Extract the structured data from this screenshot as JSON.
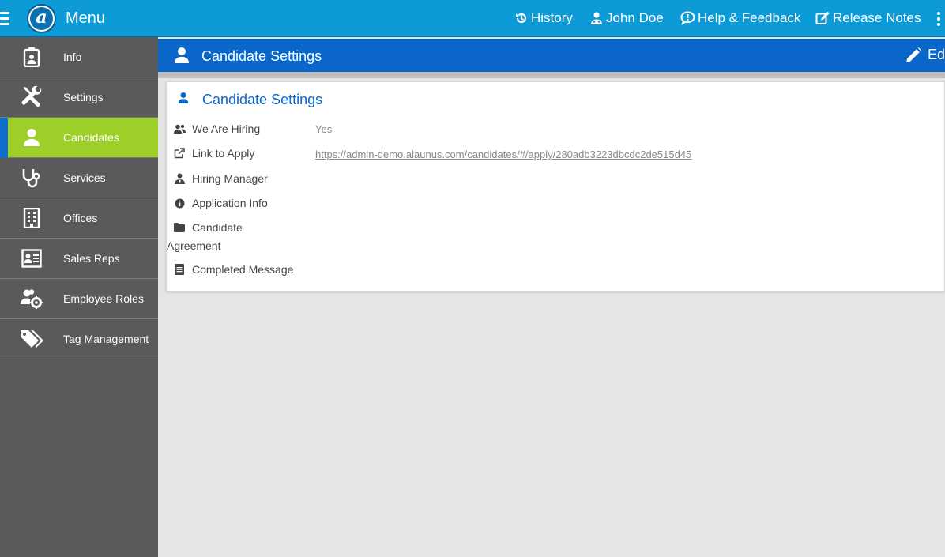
{
  "topbar": {
    "menu_label": "Menu",
    "logo_letter": "a",
    "links": {
      "history": "History",
      "user": "John Doe",
      "help": "Help & Feedback",
      "release": "Release Notes"
    }
  },
  "sidebar": {
    "items": [
      {
        "label": "Info",
        "icon": "id-badge-icon"
      },
      {
        "label": "Settings",
        "icon": "wrench-screwdriver-icon"
      },
      {
        "label": "Candidates",
        "icon": "user-icon"
      },
      {
        "label": "Services",
        "icon": "stethoscope-icon"
      },
      {
        "label": "Offices",
        "icon": "building-icon"
      },
      {
        "label": "Sales Reps",
        "icon": "contact-card-icon"
      },
      {
        "label": "Employee Roles",
        "icon": "users-cog-icon"
      },
      {
        "label": "Tag Management",
        "icon": "tags-icon"
      }
    ],
    "active_index": 2
  },
  "header": {
    "title": "Candidate Settings",
    "edit_label": "Ed"
  },
  "card": {
    "title": "Candidate Settings",
    "rows": {
      "hiring": {
        "label": "We Are Hiring",
        "value": "Yes"
      },
      "link": {
        "label": "Link to Apply",
        "value": "https://admin-demo.alaunus.com/candidates/#/apply/280adb3223dbcdc2de515d45"
      },
      "manager": {
        "label": "Hiring Manager"
      },
      "appinfo": {
        "label": "Application Info"
      },
      "agreement": {
        "label_line1": "Candidate",
        "label_line2": "Agreement"
      },
      "completed": {
        "label": "Completed Message"
      }
    }
  },
  "colors": {
    "topbar": "#0d9bd7",
    "header": "#0a66c8",
    "sidebar": "#5a5a5a",
    "active": "#9ecf28"
  }
}
